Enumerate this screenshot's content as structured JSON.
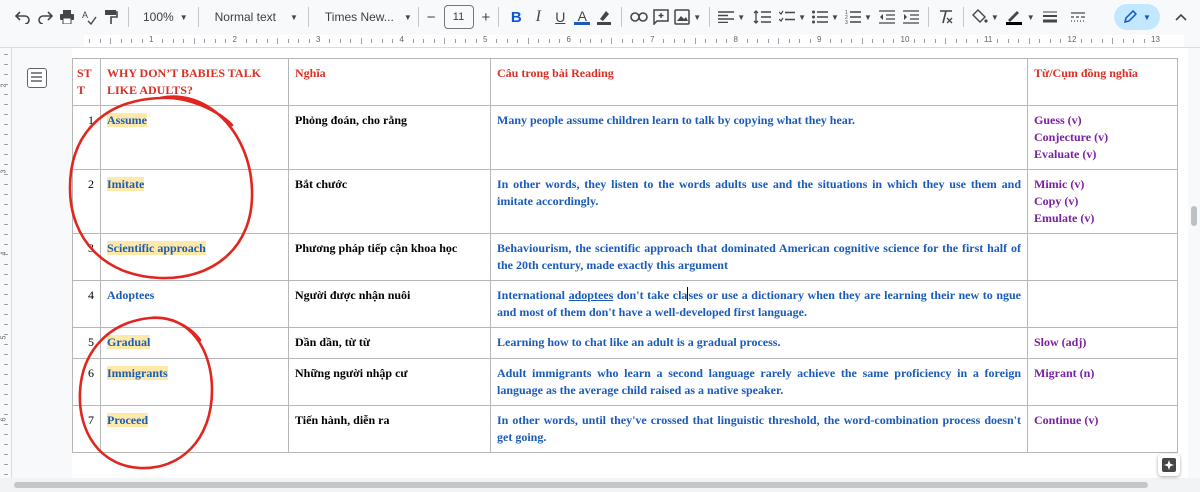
{
  "toolbar": {
    "zoom": "100%",
    "style": "Normal text",
    "font": "Times New...",
    "font_size": "11",
    "minus": "−",
    "plus": "+",
    "bold": "B",
    "italic": "I",
    "underline": "U",
    "text_color": "A"
  },
  "ruler": {
    "numbers": [
      "1",
      "2",
      "3",
      "4",
      "5",
      "6",
      "7",
      "8",
      "9",
      "10",
      "11",
      "12",
      "13"
    ]
  },
  "vruler": {
    "numbers": [
      "2",
      "3",
      "4",
      "5",
      "6"
    ]
  },
  "table": {
    "headers": {
      "stt": "ST T",
      "word": "WHY DON’T BABIES TALK LIKE ADULTS?",
      "meaning": "Nghĩa",
      "sentence": "Câu trong bài Reading",
      "synonyms": "Từ/Cụm đồng nghĩa"
    },
    "rows": [
      {
        "stt": "1",
        "word": "Assume",
        "meaning": "Phỏng đoán, cho rằng",
        "sentence": "Many people assume children learn to talk by copying what they hear.",
        "synonyms": [
          "Guess (v)",
          "Conjecture (v)",
          "Evaluate (v)"
        ]
      },
      {
        "stt": "2",
        "word": "Imitate",
        "meaning": "Bắt chước",
        "sentence": "In other words, they listen to the words adults use and the situations in which they use them and imitate accordingly.",
        "synonyms": [
          "Mimic (v)",
          "Copy (v)",
          "Emulate (v)"
        ]
      },
      {
        "stt": "3",
        "word": "Scientific approach",
        "meaning": "Phương pháp tiếp cận khoa học",
        "sentence": "Behaviourism, the scientific approach that dominated American cognitive science for the first half of the 20th century, made exactly this argument",
        "synonyms": []
      },
      {
        "stt": "4",
        "word": "Adoptees",
        "meaning": "Người được nhận nuôi",
        "sentence_parts": {
          "before": "International ",
          "link": "adoptees",
          "middle": " don't take cla",
          "after": "ses or use a dictionary when they are learning their new to ngue and most of them don't have a well-developed first language."
        },
        "synonyms": []
      },
      {
        "stt": "5",
        "word": "Gradual",
        "meaning": "Dần dần, từ từ",
        "sentence": "Learning how to chat like an adult is a gradual process.",
        "synonyms": [
          "Slow (adj)"
        ]
      },
      {
        "stt": "6",
        "word": "Immigrants",
        "meaning": "Những người nhập cư",
        "sentence": "Adult immigrants who learn a second language rarely achieve the same proficiency in a foreign language as the average child raised as a native speaker.",
        "synonyms": [
          "Migrant (n)"
        ]
      },
      {
        "stt": "7",
        "word": "Proceed",
        "meaning": "Tiến hành, diễn ra",
        "sentence": "In other words, until they've crossed that linguistic threshold, the word-combination process doesn't get going.",
        "synonyms": [
          "Continue (v)"
        ]
      }
    ]
  },
  "colors": {
    "header_red": "#d93025",
    "word_blue": "#1a5bb8",
    "synonym_purple": "#7b1fa2",
    "highlight": "#ffe9a8",
    "annotation_red": "#e0261f"
  }
}
